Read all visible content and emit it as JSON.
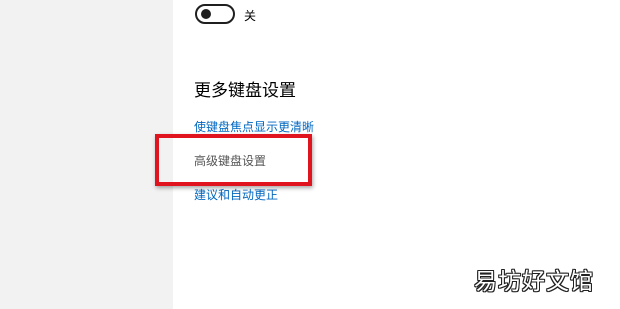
{
  "toggle": {
    "state_label": "关",
    "on": false
  },
  "section": {
    "heading": "更多键盘设置",
    "links": [
      {
        "label": "使键盘焦点显示更清晰"
      },
      {
        "label": "高级键盘设置"
      },
      {
        "label": "建议和自动更正"
      }
    ]
  },
  "annotation": {
    "highlight_color": "#e0141e"
  },
  "watermark": {
    "text": "易坊好文馆"
  },
  "colors": {
    "link": "#0067c0",
    "sidebar_bg": "#f2f2f2"
  }
}
